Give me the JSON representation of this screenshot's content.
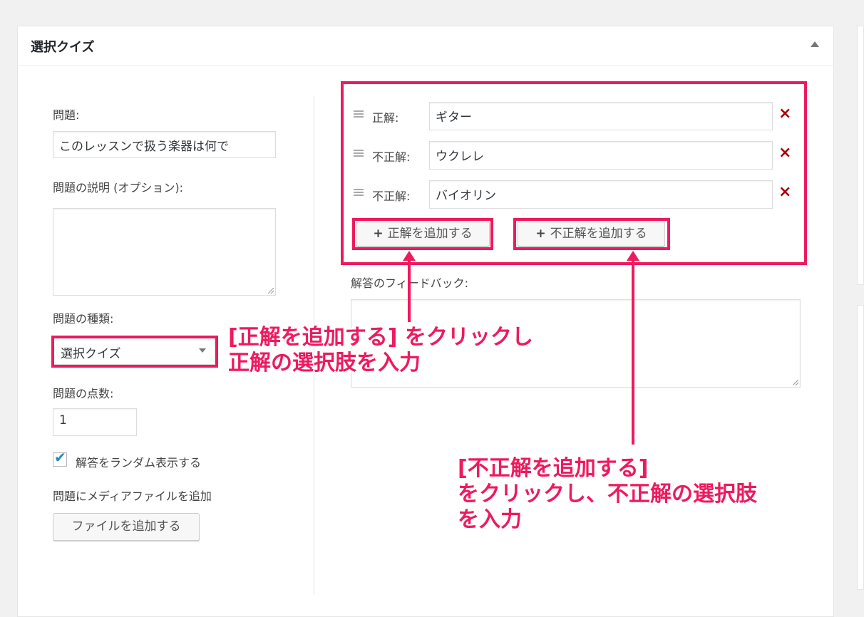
{
  "panel": {
    "title": "選択クイズ"
  },
  "question": {
    "label": "問題:",
    "value": "このレッスンで扱う楽器は何で"
  },
  "description": {
    "label": "問題の説明 (オプション):",
    "value": ""
  },
  "type": {
    "label": "問題の種類:",
    "selected": "選択クイズ"
  },
  "points": {
    "label": "問題の点数:",
    "value": "1"
  },
  "randomize": {
    "label": "解答をランダム表示する",
    "checked": true
  },
  "media": {
    "label": "問題にメディアファイルを追加",
    "button": "ファイルを追加する"
  },
  "answers": [
    {
      "label": "正解:",
      "value": "ギター"
    },
    {
      "label": "不正解:",
      "value": "ウクレレ"
    },
    {
      "label": "不正解:",
      "value": "バイオリン"
    }
  ],
  "buttons": {
    "add_correct": "正解を追加する",
    "add_wrong": "不正解を追加する"
  },
  "feedback": {
    "label": "解答のフィードバック:",
    "value": ""
  },
  "annotations": {
    "correct_line1": "[正解を追加する] をクリックし",
    "correct_line2": "正解の選択肢を入力",
    "wrong_line1": "[不正解を追加する]",
    "wrong_line2": "をクリックし、不正解の選択肢",
    "wrong_line3": "を入力"
  },
  "colors": {
    "highlight": "#ee1a5e",
    "delete": "#aa0000",
    "checkmark": "#1e8cbe"
  },
  "icons": [
    "collapse-arrow-icon",
    "drag-handle-icon",
    "delete-x-icon",
    "plus-icon",
    "checkmark-icon",
    "select-arrow-icon"
  ]
}
